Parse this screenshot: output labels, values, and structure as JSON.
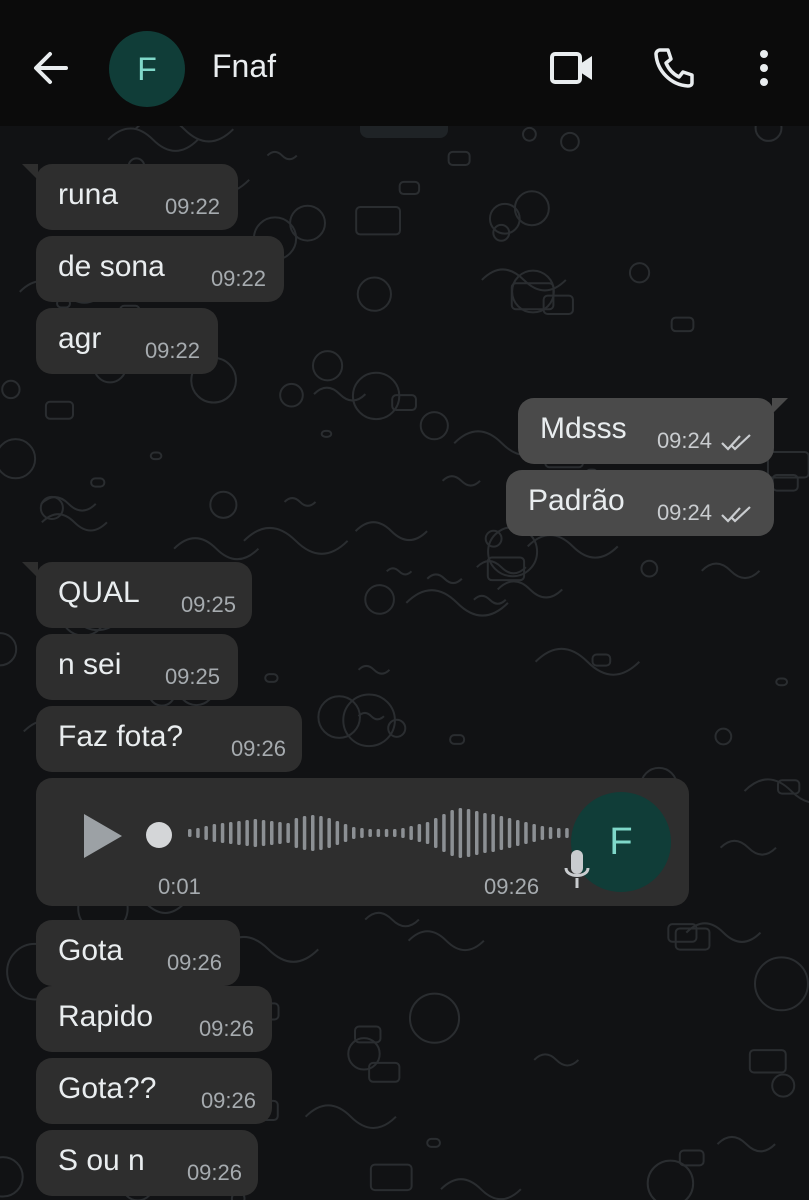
{
  "header": {
    "contact_name": "Fnaf",
    "avatar_letter": "F"
  },
  "messages": [
    {
      "dir": "in",
      "text": "runa",
      "time": "09:22"
    },
    {
      "dir": "in",
      "text": "de sona",
      "time": "09:22"
    },
    {
      "dir": "in",
      "text": "agr",
      "time": "09:22"
    },
    {
      "dir": "out",
      "text": "Mdsss",
      "time": "09:24",
      "status": "read"
    },
    {
      "dir": "out",
      "text": "Padrão",
      "time": "09:24",
      "status": "read"
    },
    {
      "dir": "in",
      "text": "QUAL",
      "time": "09:25"
    },
    {
      "dir": "in",
      "text": "n sei",
      "time": "09:25"
    },
    {
      "dir": "in",
      "text": "Faz fota?",
      "time": "09:26"
    },
    {
      "dir": "in",
      "text": "Gota",
      "time": "09:26"
    },
    {
      "dir": "in",
      "text": "Rapido",
      "time": "09:26"
    },
    {
      "dir": "in",
      "text": "Gota??",
      "time": "09:26"
    },
    {
      "dir": "in",
      "text": "S ou n",
      "time": "09:26"
    }
  ],
  "voice_note": {
    "duration": "0:01",
    "time": "09:26",
    "avatar_letter": "F",
    "progress": 0
  },
  "colors": {
    "background": "#0b0b0b",
    "incoming_bubble": "#2e2e2e",
    "outgoing_bubble": "#4a4a4a",
    "avatar_bg": "#103d38",
    "avatar_letter": "#7fd8c9"
  },
  "icons": [
    "back-arrow-icon",
    "video-call-icon",
    "phone-icon",
    "more-options-icon",
    "play-icon",
    "microphone-icon",
    "double-check-icon"
  ]
}
